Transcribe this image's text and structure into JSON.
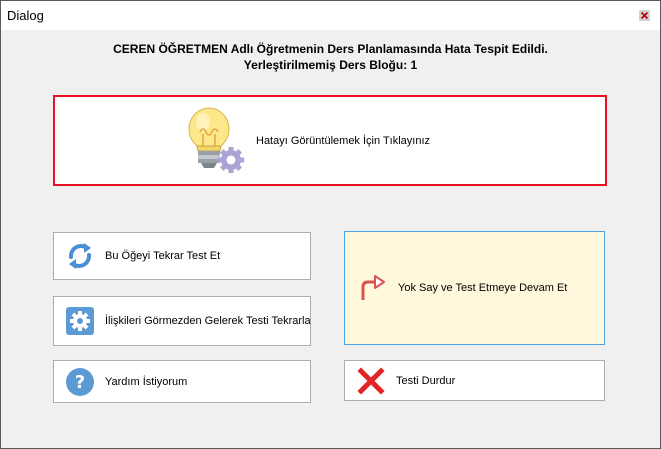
{
  "window": {
    "title": "Dialog"
  },
  "heading": {
    "line1": "CEREN ÖĞRETMEN Adlı Öğretmenin Ders Planlamasında Hata Tespit Edildi.",
    "line2": "Yerleştirilmemiş Ders Bloğu: 1"
  },
  "error_panel": {
    "label": "Hatayı Görüntülemek İçin Tıklayınız",
    "icon": "lightbulb-gear-icon"
  },
  "buttons": {
    "retest": {
      "label": "Bu Öğeyi Tekrar Test Et",
      "icon": "refresh-icon"
    },
    "ignore_relations": {
      "label": "İlişkileri Görmezden Gelerek Testi Tekrarla",
      "icon": "gear-icon"
    },
    "help": {
      "label": "Yardım İstiyorum",
      "icon": "help-icon"
    },
    "continue": {
      "label": "Yok Say ve Test Etmeye Devam Et",
      "icon": "redirect-arrow-icon"
    },
    "stop": {
      "label": "Testi Durdur",
      "icon": "red-x-icon"
    }
  },
  "colors": {
    "error_border": "#e81123",
    "highlight_background": "#fff8dc",
    "highlight_border": "#4da3e6"
  }
}
